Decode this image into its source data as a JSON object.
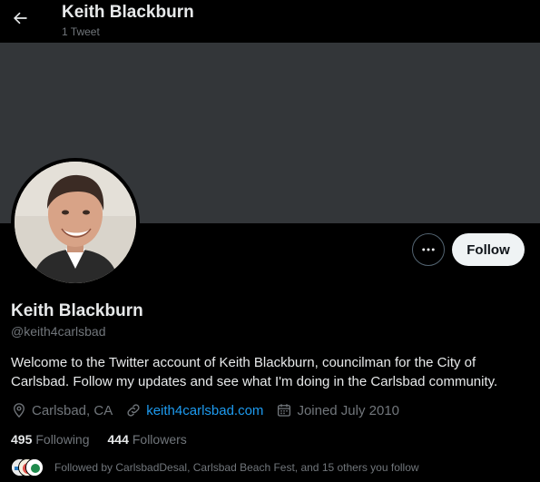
{
  "header": {
    "title": "Keith Blackburn",
    "subtitle": "1 Tweet"
  },
  "profile": {
    "display_name": "Keith Blackburn",
    "handle": "@keith4carlsbad",
    "bio": "Welcome to the Twitter account of Keith Blackburn, councilman for the City of Carlsbad. Follow my updates and see what I'm doing in the Carlsbad community.",
    "location": "Carlsbad, CA",
    "website": "keith4carlsbad.com",
    "joined": "Joined July 2010"
  },
  "actions": {
    "follow_label": "Follow",
    "more_icon": "more-horizontal-icon"
  },
  "stats": {
    "following_count": "495",
    "following_label": "Following",
    "followers_count": "444",
    "followers_label": "Followers"
  },
  "followed_by": {
    "text": "Followed by CarlsbadDesal, Carlsbad Beach Fest, and 15 others you follow"
  },
  "colors": {
    "background": "#000000",
    "banner": "#333639",
    "accent_link": "#1d9bf0",
    "muted_text": "#71767b",
    "follow_button": "#eff3f4"
  }
}
